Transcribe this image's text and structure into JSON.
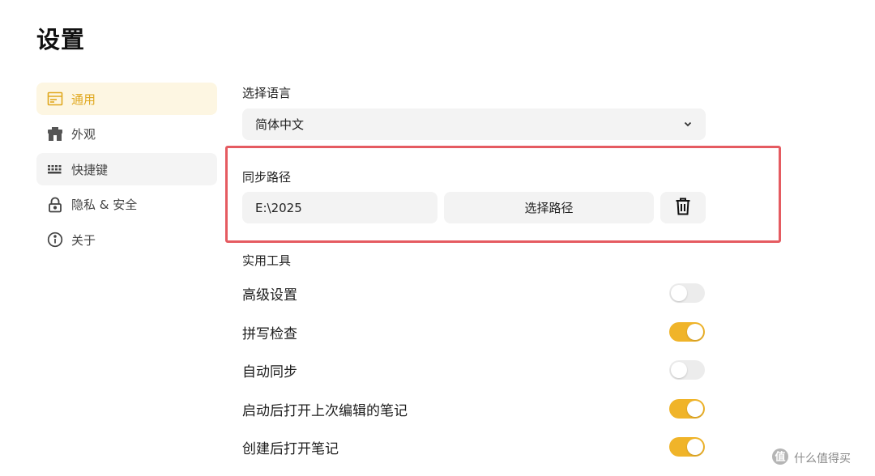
{
  "page": {
    "title": "设置"
  },
  "sidebar": {
    "items": [
      {
        "label": "通用",
        "icon": "window-icon",
        "active": true
      },
      {
        "label": "外观",
        "icon": "shop-icon"
      },
      {
        "label": "快捷键",
        "icon": "keyboard-icon"
      },
      {
        "label": "隐私 & 安全",
        "icon": "lock-icon"
      },
      {
        "label": "关于",
        "icon": "info-icon"
      }
    ]
  },
  "language": {
    "label": "选择语言",
    "selected": "简体中文"
  },
  "sync": {
    "label": "同步路径",
    "path_value": "E:\\2025",
    "choose_label": "选择路径"
  },
  "tools": {
    "label": "实用工具",
    "items": [
      {
        "label": "高级设置",
        "enabled": false
      },
      {
        "label": "拼写检查",
        "enabled": true
      },
      {
        "label": "自动同步",
        "enabled": false
      },
      {
        "label": "启动后打开上次编辑的笔记",
        "enabled": true
      },
      {
        "label": "创建后打开笔记",
        "enabled": true
      }
    ]
  },
  "colors": {
    "accent": "#f0b429",
    "active_bg": "#fdf6e2",
    "highlight_border": "#e55b61"
  },
  "watermark": {
    "text": "什么值得买"
  }
}
